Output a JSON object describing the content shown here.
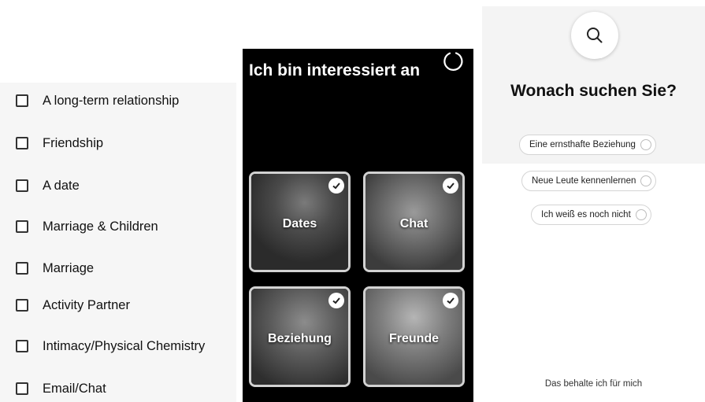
{
  "left": {
    "options": [
      {
        "label": "A long-term relationship"
      },
      {
        "label": "Friendship"
      },
      {
        "label": "A date"
      },
      {
        "label": "Marriage & Children"
      },
      {
        "label": "Marriage"
      },
      {
        "label": "Activity Partner"
      },
      {
        "label": "Intimacy/Physical Chemistry"
      },
      {
        "label": "Email/Chat"
      }
    ]
  },
  "middle": {
    "title": "Ich bin interessiert an",
    "tiles": [
      {
        "label": "Dates",
        "selected": true
      },
      {
        "label": "Chat",
        "selected": true
      },
      {
        "label": "Beziehung",
        "selected": true
      },
      {
        "label": "Freunde",
        "selected": true
      }
    ]
  },
  "right": {
    "icon": "search-icon",
    "question": "Wonach suchen Sie?",
    "options": [
      {
        "label": "Eine ernsthafte Beziehung"
      },
      {
        "label": "Neue Leute kennenlernen"
      },
      {
        "label": "Ich weiß es noch nicht"
      }
    ],
    "footer": "Das behalte ich für mich"
  }
}
